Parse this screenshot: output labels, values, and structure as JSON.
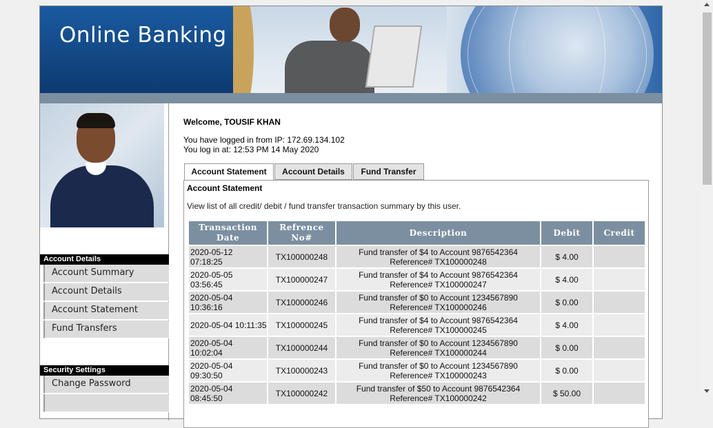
{
  "header": {
    "title": "Online Banking"
  },
  "user": {
    "welcome": "Welcome, TOUSIF KHAN",
    "ip_line": "You have logged in from IP: 172.69.134.102",
    "login_line": "You log in at: 12:53 PM 14 May 2020"
  },
  "sidebar": {
    "section1": "Account Details",
    "section1_items": [
      "Account Summary",
      "Account Details",
      "Account Statement",
      "Fund Transfers"
    ],
    "section2": "Security Settings",
    "section2_items": [
      "Change Password"
    ]
  },
  "tabs": [
    "Account Statement",
    "Account Details",
    "Fund Transfer"
  ],
  "panel": {
    "title": "Account Statement",
    "description": "View list of all credit/ debit / fund transfer transaction summary by this user."
  },
  "table": {
    "headers": [
      "Transaction Date",
      "Refrence No#",
      "Description",
      "Debit",
      "Credit"
    ],
    "rows": [
      {
        "date": "2020-05-12 07:18:25",
        "ref": "TX100000248",
        "desc1": "Fund transfer of $4 to Account 9876542364",
        "desc2": "Reference# TX100000248",
        "debit": "$ 4.00",
        "credit": ""
      },
      {
        "date": "2020-05-05 03:56:45",
        "ref": "TX100000247",
        "desc1": "Fund transfer of $4 to Account 9876542364",
        "desc2": "Reference# TX100000247",
        "debit": "$ 4.00",
        "credit": ""
      },
      {
        "date": "2020-05-04 10:36:16",
        "ref": "TX100000246",
        "desc1": "Fund transfer of $0 to Account 1234567890",
        "desc2": "Reference# TX100000246",
        "debit": "$ 0.00",
        "credit": ""
      },
      {
        "date": "2020-05-04 10:11:35",
        "ref": "TX100000245",
        "desc1": "Fund transfer of $4 to Account 9876542364",
        "desc2": "Reference# TX100000245",
        "debit": "$ 4.00",
        "credit": ""
      },
      {
        "date": "2020-05-04 10:02:04",
        "ref": "TX100000244",
        "desc1": "Fund transfer of $0 to Account 1234567890",
        "desc2": "Reference# TX100000244",
        "debit": "$ 0.00",
        "credit": ""
      },
      {
        "date": "2020-05-04 09:30:50",
        "ref": "TX100000243",
        "desc1": "Fund transfer of $0 to Account 1234567890",
        "desc2": "Reference# TX100000243",
        "debit": "$ 0.00",
        "credit": ""
      },
      {
        "date": "2020-05-04 08:45:50",
        "ref": "TX100000242",
        "desc1": "Fund transfer of $50 to Account 9876542364",
        "desc2": "Reference# TX100000242",
        "debit": "$ 50.00",
        "credit": ""
      }
    ]
  },
  "colors": {
    "header_bg": "#0f3f78",
    "table_header": "#7b8fa1",
    "row_dark": "#dcdcdc",
    "row_light": "#ececec"
  }
}
